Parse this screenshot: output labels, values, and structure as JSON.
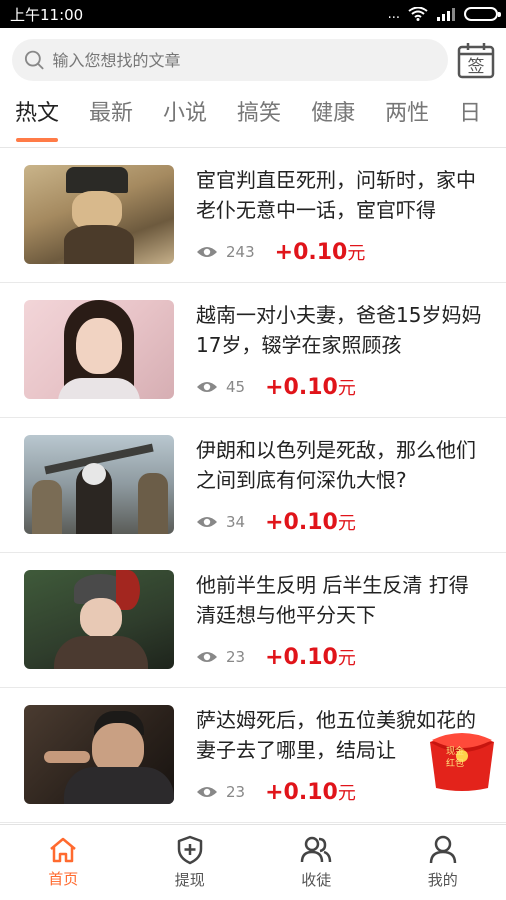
{
  "status": {
    "time": "上午11:00",
    "signal": "...",
    "battery_level": 0.9
  },
  "search": {
    "placeholder": "输入您想找的文章",
    "checkin_label": "签"
  },
  "tabs": [
    {
      "label": "热文",
      "active": true
    },
    {
      "label": "最新",
      "active": false
    },
    {
      "label": "小说",
      "active": false
    },
    {
      "label": "搞笑",
      "active": false
    },
    {
      "label": "健康",
      "active": false
    },
    {
      "label": "两性",
      "active": false
    },
    {
      "label": "日",
      "active": false
    }
  ],
  "articles": [
    {
      "title": "宦官判直臣死刑，问斩时，家中老仆无意中一话，宦官吓得",
      "views": "243",
      "reward": "+0.10",
      "unit": "元"
    },
    {
      "title": "越南一对小夫妻，爸爸15岁妈妈17岁，辍学在家照顾孩",
      "views": "45",
      "reward": "+0.10",
      "unit": "元"
    },
    {
      "title": "伊朗和以色列是死敌，那么他们之间到底有何深仇大恨?",
      "views": "34",
      "reward": "+0.10",
      "unit": "元"
    },
    {
      "title": "他前半生反明 后半生反清 打得清廷想与他平分天下",
      "views": "23",
      "reward": "+0.10",
      "unit": "元"
    },
    {
      "title": "萨达姆死后，他五位美貌如花的妻子去了哪里，结局让",
      "views": "23",
      "reward": "+0.10",
      "unit": "元"
    }
  ],
  "redpack": {
    "line1": "现金",
    "line2": "红包"
  },
  "tabbar": [
    {
      "label": "首页",
      "icon": "home-icon",
      "active": true
    },
    {
      "label": "提现",
      "icon": "withdraw-shield-icon",
      "active": false
    },
    {
      "label": "收徒",
      "icon": "apprentice-users-icon",
      "active": false
    },
    {
      "label": "我的",
      "icon": "profile-icon",
      "active": false
    }
  ],
  "colors": {
    "accent": "#ff6a2f",
    "reward": "#e0141a"
  }
}
